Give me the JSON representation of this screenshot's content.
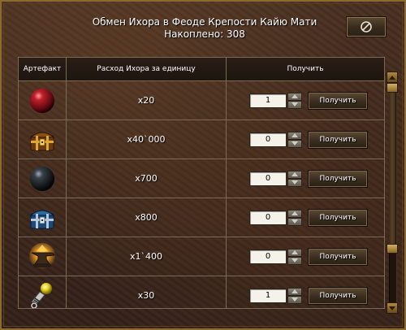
{
  "header": {
    "title": "Обмен Ихора в Феоде Крепости Кайю Мати",
    "accumulated": "Накоплено: 308"
  },
  "close_button": {
    "icon": "prohibited-icon"
  },
  "table": {
    "columns": [
      "Артефакт",
      "Расход Ихора за единицу",
      "Получить"
    ],
    "rows": [
      {
        "artifact_icon": "red-orb-icon",
        "cost": "x20",
        "quantity": "1",
        "button": "Получить"
      },
      {
        "artifact_icon": "golden-chest-icon",
        "cost": "x40`000",
        "quantity": "0",
        "button": "Получить"
      },
      {
        "artifact_icon": "black-orb-icon",
        "cost": "x700",
        "quantity": "0",
        "button": "Получить"
      },
      {
        "artifact_icon": "blue-chest-icon",
        "cost": "x800",
        "quantity": "0",
        "button": "Получить"
      },
      {
        "artifact_icon": "anvil-icon",
        "cost": "x1`400",
        "quantity": "0",
        "button": "Получить"
      },
      {
        "artifact_icon": "magic-lamp-icon",
        "cost": "x30",
        "quantity": "1",
        "button": "Получить"
      }
    ]
  },
  "colors": {
    "text": "#ffffff",
    "border": "#7a6a55",
    "frame_gold": "#8a6a2e",
    "background": "#3d271b"
  }
}
